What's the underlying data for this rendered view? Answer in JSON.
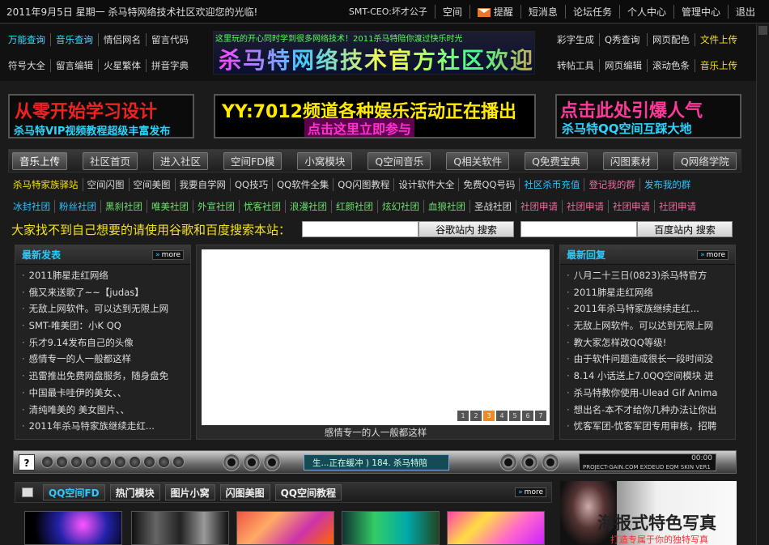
{
  "topbar": {
    "greeting": "2011年9月5日 星期一 杀马特网络技术社区欢迎您的光临!",
    "user": "SMT-CEO:坏才公子",
    "links": [
      "空间",
      "提醒",
      "短消息",
      "论坛任务",
      "个人中心",
      "管理中心",
      "退出"
    ]
  },
  "header": {
    "left_links_row1": [
      "万能查询",
      "音乐查询",
      "情侣网名",
      "留言代码"
    ],
    "left_links_row2": [
      "符号大全",
      "留言编辑",
      "火星繁体",
      "拼音字典"
    ],
    "right_links_row1": [
      "彩字生成",
      "Q秀查询",
      "网页配色",
      "文件上传"
    ],
    "right_links_row2": [
      "转帖工具",
      "网页编辑",
      "滚动色条",
      "音乐上传"
    ],
    "marquee": "这里玩的开心同时学到很多网络技术！2011杀马特陪你渡过快乐时光",
    "banner_title": "杀马特网络技术官方社区欢迎您"
  },
  "ads": {
    "ad1_title": "从零开始学习设计",
    "ad1_sub": "杀马特VIP视频教程超级丰富发布",
    "ad2_title": "YY:7012频道各种娱乐活动正在播出",
    "ad2_sub": "点击这里立即参与",
    "ad3_title": "点击此处引爆人气",
    "ad3_sub": "杀马特QQ空间互踩大地"
  },
  "nav": [
    "音乐上传",
    "社区首页",
    "进入社区",
    "空间FD模",
    "小窝模块",
    "Q空间音乐",
    "Q相关软件",
    "Q免费宝典",
    "闪图素材",
    "Q网络学院"
  ],
  "links_row1": [
    "杀马特家族驿站",
    "空间闪图",
    "空间美图",
    "我要自学网",
    "QQ技巧",
    "QQ软件全集",
    "QQ闪图教程",
    "设计软件大全",
    "免费QQ号码",
    "社区杀币充值",
    "登记我的群",
    "发布我的群"
  ],
  "links_row2": [
    "冰封社团",
    "粉丝社团",
    "黑刹社团",
    "唯美社团",
    "外宣社团",
    "忧客社团",
    "浪漫社团",
    "红颜社团",
    "炫幻社团",
    "血狼社团",
    "圣战社团",
    "社团申请",
    "社团申请",
    "社团申请",
    "社团申请"
  ],
  "search": {
    "label": "大家找不到自己想要的请使用谷歌和百度搜索本站：",
    "google_btn": "谷歌站内 搜索",
    "baidu_btn": "百度站内 搜索",
    "placeholder": ""
  },
  "latest_posts": {
    "title": "最新发表",
    "more": "more",
    "items": [
      "2011肺星走红网络",
      "俄又来送歌了~~【judas】",
      "无敌上网软件。可以达到无限上网",
      "SMT-唯美团：小K QQ",
      "乐才9.14发布自己的头像",
      "感情专一的人一般都这样",
      "迅雷推出免费网盘服务，随身盘免",
      "中国最卡哇伊的美女、、",
      "清纯唯美的 美女图片、、",
      "2011年杀马特家族继续走红..."
    ]
  },
  "latest_replies": {
    "title": "最新回复",
    "more": "more",
    "items": [
      "八月二十三日(0823)杀马特官方",
      "2011肺星走红网络",
      "2011年杀马特家族继续走红...",
      "无敌上网软件。可以达到无限上网",
      "教大家怎样改QQ等级!",
      "由于软件问题造成很长一段时间没",
      "8.14 小话送上7.0QQ空间模块 进",
      "杀马特教你使用-Ulead Gif Anima",
      "想出名-本不才给你几种办法让你出",
      "忧客军团-忧客军团专用审核，招聘"
    ]
  },
  "slideshow": {
    "caption": "感情专一的人一般都这样",
    "pages": [
      "1",
      "2",
      "3",
      "4",
      "5",
      "6",
      "7"
    ],
    "active": 3
  },
  "player": {
    "now_playing": "生...正在缓冲 ) 184. 杀马特陪",
    "lcd_right": "PROJECT-GAIN.COM EXDEUD EQM SKIN VER1",
    "time": "00:00"
  },
  "tabs": [
    "QQ空间FD",
    "热门模块",
    "图片小窝",
    "闪图美图",
    "QQ空间教程"
  ],
  "tabs_more": "more",
  "poster": {
    "title": "海报式特色写真",
    "sub": "打造专属于你的独特写真"
  },
  "colors": {
    "accent_cyan": "#2dc8ff",
    "accent_yellow": "#f5e21b",
    "link_green": "#6fe06f",
    "link_pink": "#f06aa0"
  }
}
